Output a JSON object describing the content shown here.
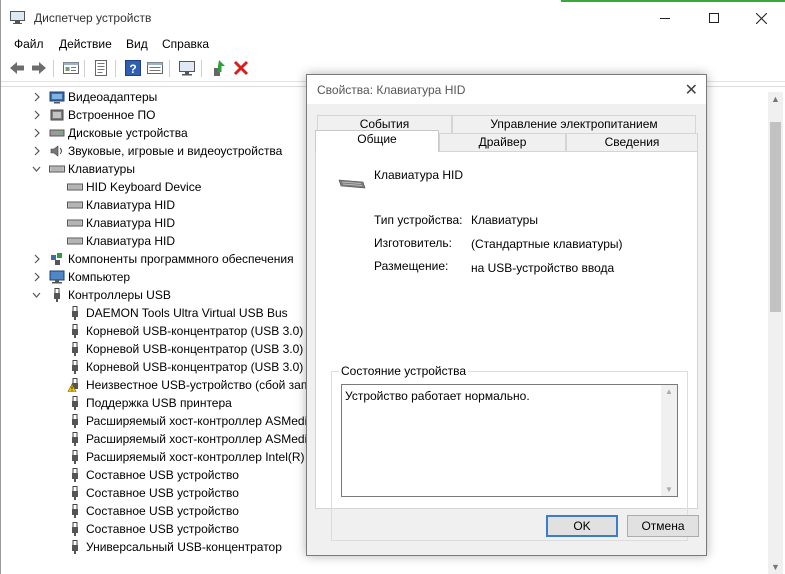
{
  "window": {
    "title": "Диспетчер устройств",
    "minimize_icon": "minimize-icon",
    "maximize_icon": "maximize-icon",
    "close_icon": "close-icon"
  },
  "menu": {
    "file": "Файл",
    "action": "Действие",
    "view": "Вид",
    "help": "Справка"
  },
  "toolbar": {
    "icons": [
      "back-icon",
      "forward-icon",
      "properties-icon",
      "update-driver-icon",
      "help-icon",
      "show-hidden-icon",
      "scan-hardware-icon",
      "add-driver-icon",
      "remove-device-icon"
    ]
  },
  "tree": {
    "items": [
      {
        "label": "Видеоадаптеры",
        "level": 0,
        "icon": "display-adapter-icon",
        "expand": "collapsed"
      },
      {
        "label": "Встроенное ПО",
        "level": 0,
        "icon": "firmware-icon",
        "expand": "collapsed"
      },
      {
        "label": "Дисковые устройства",
        "level": 0,
        "icon": "disk-drive-icon",
        "expand": "collapsed"
      },
      {
        "label": "Звуковые, игровые и видеоустройства",
        "level": 0,
        "icon": "sound-icon",
        "expand": "collapsed"
      },
      {
        "label": "Клавиатуры",
        "level": 0,
        "icon": "keyboard-icon",
        "expand": "expanded"
      },
      {
        "label": "HID Keyboard Device",
        "level": 1,
        "icon": "keyboard-icon"
      },
      {
        "label": "Клавиатура HID",
        "level": 1,
        "icon": "keyboard-icon"
      },
      {
        "label": "Клавиатура HID",
        "level": 1,
        "icon": "keyboard-icon"
      },
      {
        "label": "Клавиатура HID",
        "level": 1,
        "icon": "keyboard-icon"
      },
      {
        "label": "Компоненты программного обеспечения",
        "level": 0,
        "icon": "software-component-icon",
        "expand": "collapsed"
      },
      {
        "label": "Компьютер",
        "level": 0,
        "icon": "computer-icon",
        "expand": "collapsed"
      },
      {
        "label": "Контроллеры USB",
        "level": 0,
        "icon": "usb-icon",
        "expand": "expanded"
      },
      {
        "label": "DAEMON Tools Ultra Virtual USB Bus",
        "level": 1,
        "icon": "usb-icon"
      },
      {
        "label": "Корневой USB-концентратор (USB 3.0)",
        "level": 1,
        "icon": "usb-icon"
      },
      {
        "label": "Корневой USB-концентратор (USB 3.0)",
        "level": 1,
        "icon": "usb-icon"
      },
      {
        "label": "Корневой USB-концентратор (USB 3.0)",
        "level": 1,
        "icon": "usb-icon"
      },
      {
        "label": "Неизвестное USB-устройство (сбой запр",
        "level": 1,
        "icon": "usb-warning-icon"
      },
      {
        "label": "Поддержка USB принтера",
        "level": 1,
        "icon": "usb-icon"
      },
      {
        "label": "Расширяемый хост-контроллер ASMedi",
        "level": 1,
        "icon": "usb-icon"
      },
      {
        "label": "Расширяемый хост-контроллер ASMedi",
        "level": 1,
        "icon": "usb-icon"
      },
      {
        "label": "Расширяемый хост-контроллер Intel(R)",
        "level": 1,
        "icon": "usb-icon"
      },
      {
        "label": "Составное USB устройство",
        "level": 1,
        "icon": "usb-icon"
      },
      {
        "label": "Составное USB устройство",
        "level": 1,
        "icon": "usb-icon"
      },
      {
        "label": "Составное USB устройство",
        "level": 1,
        "icon": "usb-icon"
      },
      {
        "label": "Составное USB устройство",
        "level": 1,
        "icon": "usb-icon"
      },
      {
        "label": "Универсальный USB-концентратор",
        "level": 1,
        "icon": "usb-icon"
      }
    ]
  },
  "dialog": {
    "title": "Свойства: Клавиатура HID",
    "tabs_back": [
      "События",
      "Управление электропитанием"
    ],
    "tabs_front": [
      "Общие",
      "Драйвер",
      "Сведения"
    ],
    "selected_tab": "Общие",
    "device_name": "Клавиатура HID",
    "device_type_label": "Тип устройства:",
    "device_type_value": "Клавиатуры",
    "manufacturer_label": "Изготовитель:",
    "manufacturer_value": "(Стандартные клавиатуры)",
    "location_label": "Размещение:",
    "location_value": "на USB-устройство ввода",
    "status_group_label": "Состояние устройства",
    "status_text": "Устройство работает нормально.",
    "ok_label": "OK",
    "cancel_label": "Отмена"
  }
}
